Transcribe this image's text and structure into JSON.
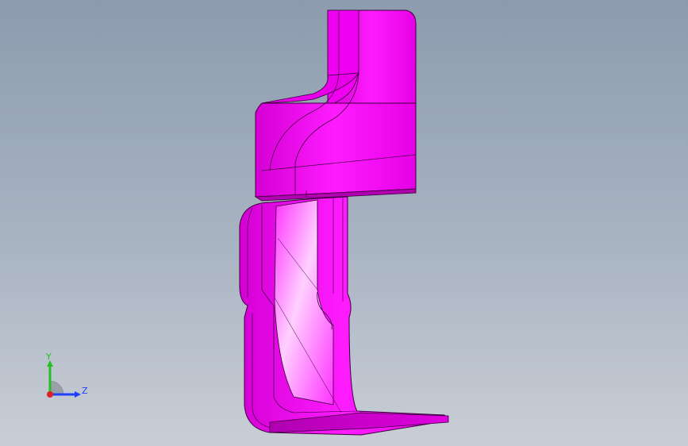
{
  "viewport": {
    "background_top": "#8c9bae",
    "background_bottom": "#c9ced6"
  },
  "model": {
    "part_color": "#ff00ff",
    "edge_color": "#3a003a",
    "shade_color": "#c000c0",
    "highlight_color": "#ffb3ff"
  },
  "triad": {
    "y_label": "Y",
    "z_label": "Z",
    "y_color": "#22c022",
    "z_color": "#2040ff",
    "x_color": "#e02020"
  }
}
